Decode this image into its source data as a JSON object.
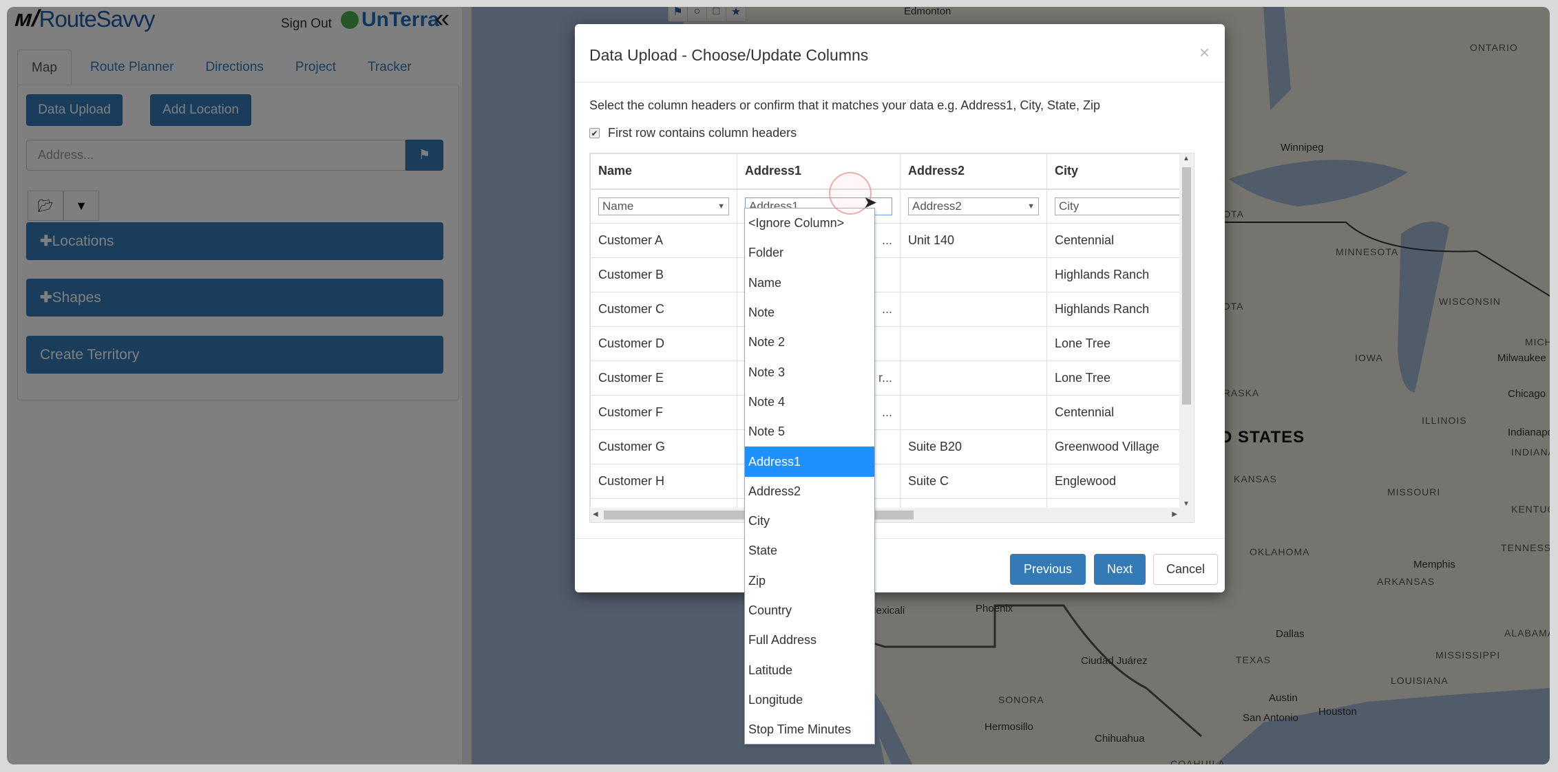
{
  "sidebar": {
    "logo": "RouteSavvy",
    "sign_out": "Sign Out",
    "partner_logo": "UnTerra",
    "collapse_icon": "double-chevron-left",
    "tabs": [
      {
        "label": "Map",
        "active": true
      },
      {
        "label": "Route Planner"
      },
      {
        "label": "Directions"
      },
      {
        "label": "Project"
      },
      {
        "label": "Tracker"
      }
    ],
    "data_upload": "Data Upload",
    "add_location": "Add Location",
    "address_placeholder": "Address...",
    "locations": "Locations",
    "shapes": "Shapes",
    "create_territory": "Create Territory",
    "primary_color": "#337ab7"
  },
  "map": {
    "tools": [
      "flag-icon",
      "circle-icon",
      "square-icon",
      "star-icon"
    ],
    "labels": [
      "Edmonton",
      "ONTARIO",
      "Winnipeg",
      "MINNESOTA",
      "WISCONSIN",
      "IOWA",
      "Milwaukee",
      "Chicago",
      "ILLINOIS",
      "Indianapolis",
      "INDIANA",
      "MICH",
      "UNITED STATES",
      "NORTH DAKOTA",
      "SOUTH DAKOTA",
      "NEBRASKA",
      "KANSAS",
      "MISSOURI",
      "KENTUCKY",
      "TENNESSEE",
      "OKLAHOMA",
      "Memphis",
      "ARKANSAS",
      "Dallas",
      "ALABAMA",
      "TEXAS",
      "MISSISSIPPI",
      "LOUISIANA",
      "Austin",
      "Houston",
      "San Antonio",
      "Phoenix",
      "Mexicali",
      "Ciudad Juárez",
      "SONORA",
      "Hermosillo",
      "Chihuahua",
      "COAHUILA"
    ]
  },
  "modal": {
    "title": "Data Upload - Choose/Update Columns",
    "close": "×",
    "instructions": "Select the column headers or confirm that it matches your data e.g. Address1, City, State, Zip",
    "first_row_headers": "First row contains column headers",
    "first_row_checked": true,
    "columns": [
      "Name",
      "Address1",
      "Address2",
      "City"
    ],
    "mappings": [
      "Name",
      "Address1",
      "Address2",
      "City"
    ],
    "rows": [
      {
        "name": "Customer A",
        "address1": "...",
        "address2": "Unit 140",
        "city": "Centennial"
      },
      {
        "name": "Customer B",
        "address1": "",
        "address2": "",
        "city": "Highlands Ranch"
      },
      {
        "name": "Customer C",
        "address1": "...",
        "address2": "",
        "city": "Highlands Ranch"
      },
      {
        "name": "Customer D",
        "address1": "",
        "address2": "",
        "city": "Lone Tree"
      },
      {
        "name": "Customer E",
        "address1": "r...",
        "address2": "",
        "city": "Lone Tree"
      },
      {
        "name": "Customer F",
        "address1": "...",
        "address2": "",
        "city": "Centennial"
      },
      {
        "name": "Customer G",
        "address1": "",
        "address2": "Suite B20",
        "city": "Greenwood Village"
      },
      {
        "name": "Customer H",
        "address1": "",
        "address2": "Suite C",
        "city": "Englewood"
      }
    ],
    "previous": "Previous",
    "next": "Next",
    "cancel": "Cancel"
  },
  "dropdown": {
    "options": [
      "<Ignore Column>",
      "Folder",
      "Name",
      "Note",
      "Note 2",
      "Note 3",
      "Note 4",
      "Note 5",
      "Address1",
      "Address2",
      "City",
      "State",
      "Zip",
      "Country",
      "Full Address",
      "Latitude",
      "Longitude",
      "Stop Time Minutes"
    ],
    "selected": "Address1",
    "highlight_color": "#1e90ff"
  }
}
